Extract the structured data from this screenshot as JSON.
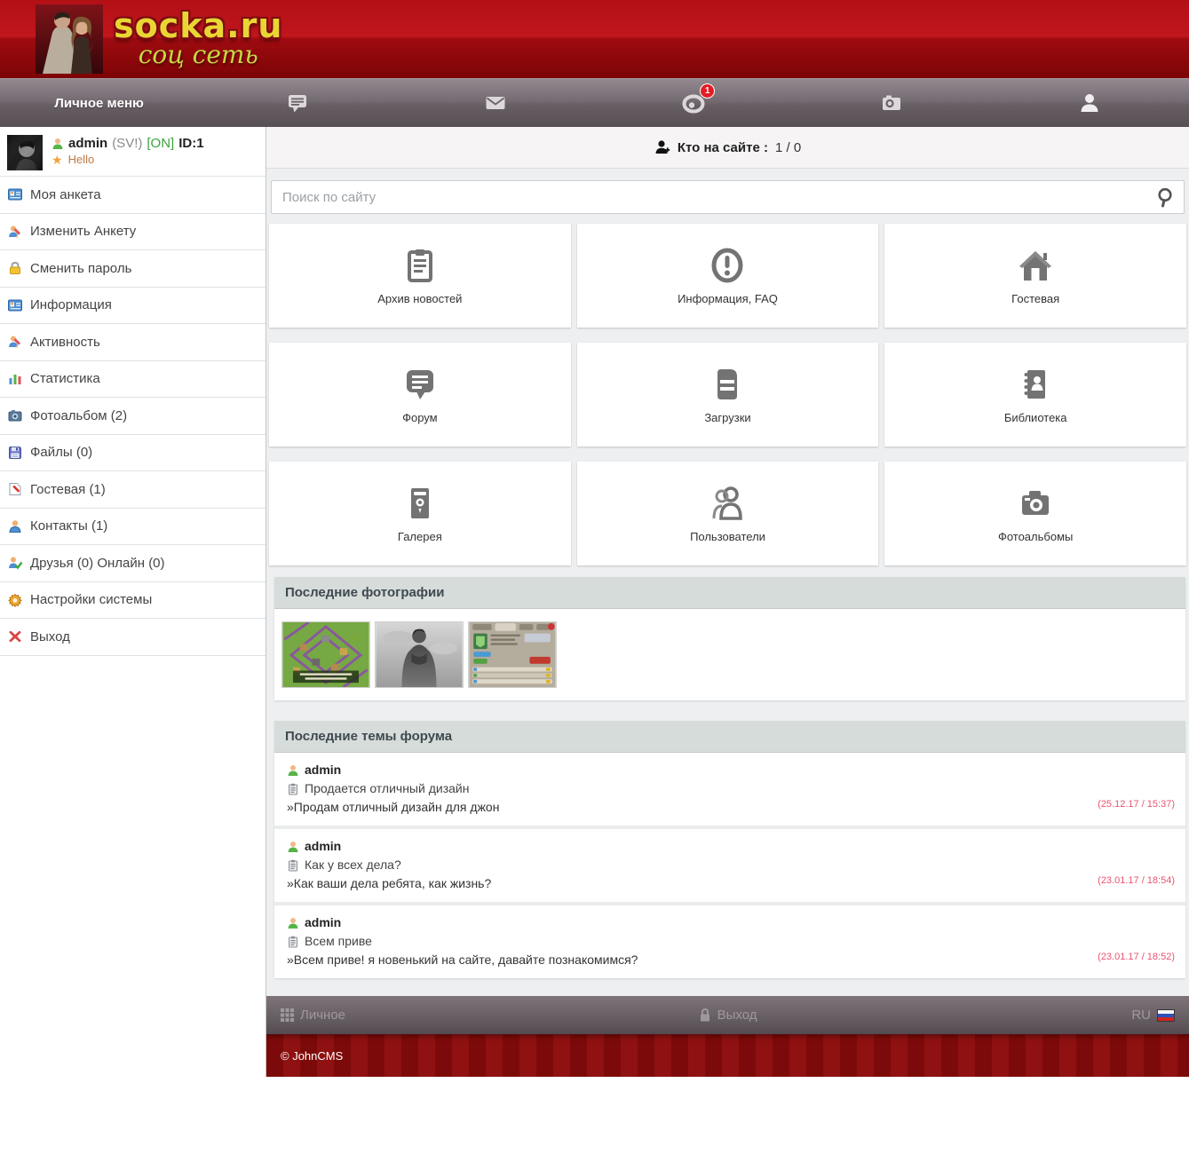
{
  "header": {
    "logo_title": "socka.ru",
    "logo_subtitle": "соц сеть"
  },
  "nav": {
    "personal_menu_label": "Личное меню",
    "notifications_badge": "1"
  },
  "user_panel": {
    "username": "admin",
    "status": "(SV!)",
    "online": "[ON]",
    "id": "ID:1",
    "greeting": "Hello"
  },
  "sidebar": {
    "items": [
      {
        "label": "Моя анкета",
        "icon": "vcard-icon"
      },
      {
        "label": "Изменить Анкету",
        "icon": "user-edit-icon"
      },
      {
        "label": "Сменить пароль",
        "icon": "lock-icon"
      },
      {
        "label": "Информация",
        "icon": "vcard-icon"
      },
      {
        "label": "Активность",
        "icon": "user-edit-icon"
      },
      {
        "label": "Статистика",
        "icon": "bar-chart-icon"
      },
      {
        "label": "Фотоальбом (2)",
        "icon": "camera-icon"
      },
      {
        "label": "Файлы (0)",
        "icon": "floppy-icon"
      },
      {
        "label": "Гостевая (1)",
        "icon": "note-edit-icon"
      },
      {
        "label": "Контакты (1)",
        "icon": "contact-icon"
      },
      {
        "label": "Друзья (0) Онлайн (0)",
        "icon": "friend-check-icon"
      },
      {
        "label": "Настройки системы",
        "icon": "gear-icon"
      },
      {
        "label": "Выход",
        "icon": "logout-x-icon"
      }
    ]
  },
  "main": {
    "who_online": {
      "label": "Кто на сайте :",
      "value": "1 / 0"
    },
    "search": {
      "placeholder": "Поиск по сайту"
    },
    "tiles": [
      {
        "label": "Архив новостей",
        "icon": "clipboard-icon"
      },
      {
        "label": "Информация, FAQ",
        "icon": "info-icon"
      },
      {
        "label": "Гостевая",
        "icon": "home-icon"
      },
      {
        "label": "Форум",
        "icon": "forum-bubble-icon"
      },
      {
        "label": "Загрузки",
        "icon": "downloads-icon"
      },
      {
        "label": "Библиотека",
        "icon": "library-icon"
      },
      {
        "label": "Галерея",
        "icon": "gallery-icon"
      },
      {
        "label": "Пользователи",
        "icon": "users-icon"
      },
      {
        "label": "Фотоальбомы",
        "icon": "photoalbum-icon"
      }
    ],
    "photos": {
      "title": "Последние фотографии",
      "thumbs": [
        "game-village-map",
        "bodybuilder-bw-photo",
        "game-clan-list"
      ]
    },
    "forum": {
      "title": "Последние темы форума",
      "topics": [
        {
          "author": "admin",
          "title": "Продается отличный дизайн",
          "last_post": "»Продам отличный дизайн для джон",
          "date": "(25.12.17 / 15:37)"
        },
        {
          "author": "admin",
          "title": "Как у всех дела?",
          "last_post": "»Как ваши дела ребята, как жизнь?",
          "date": "(23.01.17 / 18:54)"
        },
        {
          "author": "admin",
          "title": "Всем приве",
          "last_post": "»Всем приве! я новенький на сайте, давайте познакомимся?",
          "date": "(23.01.17 / 18:52)"
        }
      ]
    }
  },
  "footer": {
    "personal_label": "Личное",
    "logout_label": "Выход",
    "lang": "RU",
    "copyright": "© JohnCMS"
  },
  "colors": {
    "header_red": "#a50d12",
    "nav_gray": "#6a6167",
    "online_green": "#3aa33a",
    "date_pink": "#ea5471",
    "accent_yellow": "#e9d634"
  }
}
